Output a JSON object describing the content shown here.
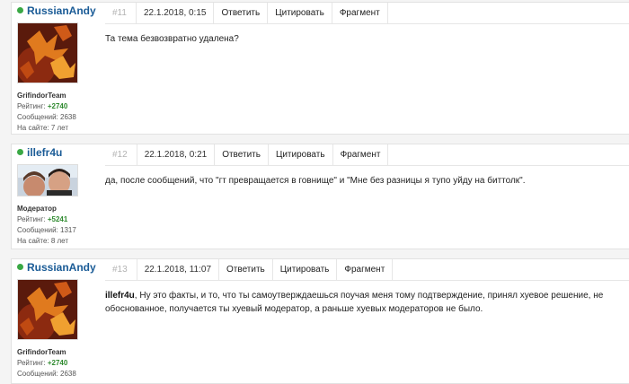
{
  "posts": [
    {
      "author": "RussianAndy",
      "group": "GrifindorTeam",
      "rating_label": "Рейтинг:",
      "rating_value": "+2740",
      "messages_line": "Сообщений: 2638",
      "onsite_line": "На сайте: 7 лет",
      "number": "#11",
      "date": "22.1.2018, 0:15",
      "reply_label": "Ответить",
      "quote_label": "Цитировать",
      "fragment_label": "Фрагмент",
      "text": "Та тема безвозвратно удалена?",
      "avatar_icon": "autumn-leaves-avatar"
    },
    {
      "author": "illefr4u",
      "group": "Модератор",
      "rating_label": "Рейтинг:",
      "rating_value": "+5241",
      "messages_line": "Сообщений: 1317",
      "onsite_line": "На сайте: 8 лет",
      "number": "#12",
      "date": "22.1.2018, 0:21",
      "reply_label": "Ответить",
      "quote_label": "Цитировать",
      "fragment_label": "Фрагмент",
      "text": "да, после сообщений, что \"гт превращается в говнище\" и \"Мне без разницы я тупо уйду на биттолк\".",
      "avatar_icon": "person-photo-avatar"
    },
    {
      "author": "RussianAndy",
      "group": "GrifindorTeam",
      "rating_label": "Рейтинг:",
      "rating_value": "+2740",
      "messages_line": "Сообщений: 2638",
      "number": "#13",
      "date": "22.1.2018, 11:07",
      "reply_label": "Ответить",
      "quote_label": "Цитировать",
      "fragment_label": "Фрагмент",
      "quote_nick": "illefr4u",
      "text": ", Ну это факты, и то, что ты самоутверждаешься поучая меня тому подтверждение, принял хуевое решение, не обоснованное, получается ты хуевый модератор, а раньше хуевых модераторов не было.",
      "avatar_icon": "autumn-leaves-avatar"
    }
  ],
  "colors": {
    "online": "#3aa845",
    "username": "#1a5b96",
    "rating": "#2f8a2f"
  }
}
